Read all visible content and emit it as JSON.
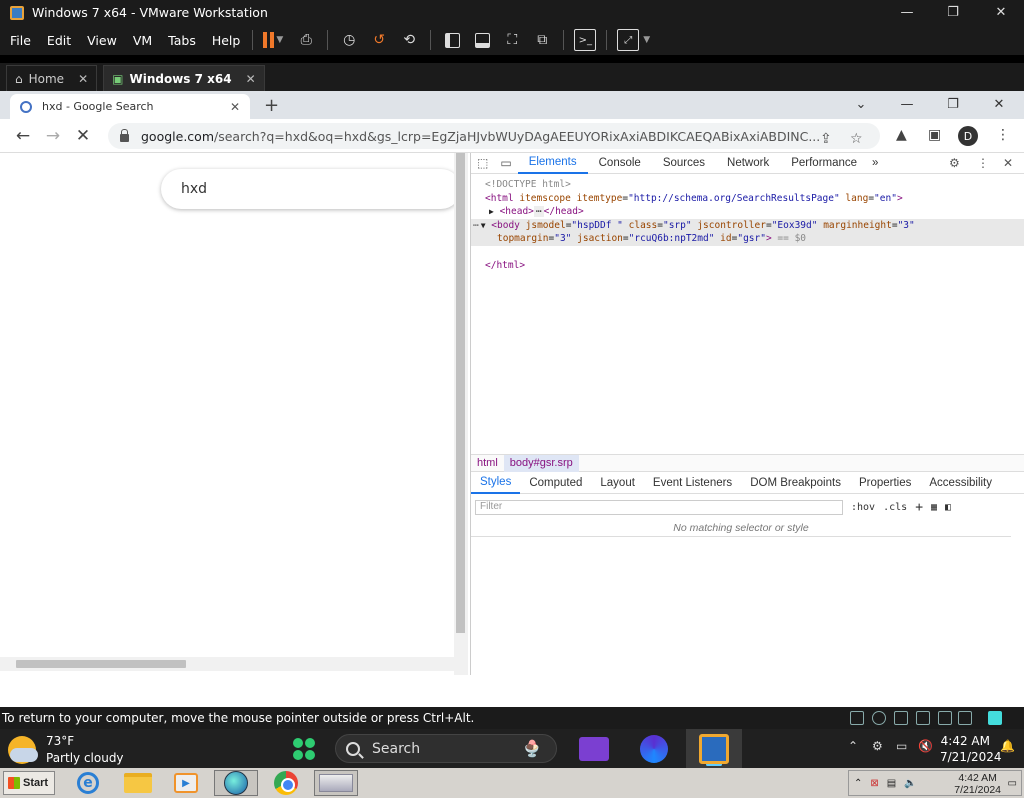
{
  "vmware": {
    "window_title": "Windows 7 x64 - VMware Workstation",
    "menu": [
      "File",
      "Edit",
      "View",
      "VM",
      "Tabs",
      "Help"
    ],
    "tabs": [
      {
        "label": "Home"
      },
      {
        "label": "Windows 7 x64"
      }
    ],
    "status_message": "To return to your computer, move the mouse pointer outside or press Ctrl+Alt."
  },
  "chrome": {
    "tab_title": "hxd - Google Search",
    "url_host": "google.com",
    "url_rest": "/search?q=hxd&oq=hxd&gs_lcrp=EgZjaHJvbWUyDAgAEEUYORixAxiABDIKCAEQABixAxiABDINC...",
    "profile_initial": "D"
  },
  "page": {
    "search_query": "hxd"
  },
  "devtools": {
    "tabs": [
      "Elements",
      "Console",
      "Sources",
      "Network",
      "Performance"
    ],
    "more_tabs": "»",
    "dom": {
      "doctype": "<!DOCTYPE html>",
      "html_open_tag": "<html",
      "html_attr1_name": "itemscope",
      "html_attr2_name": "itemtype",
      "html_attr2_value": "\"http://schema.org/SearchResultsPage\"",
      "html_attr3_name": "lang",
      "html_attr3_value": "\"en\"",
      "html_close_bracket": ">",
      "head_open": "<head>",
      "ellipsis": "⋯",
      "head_close": "</head>",
      "body_tag": "<body",
      "body_attr1_name": "jsmodel",
      "body_attr1_value": "\"hspDDf \"",
      "body_attr2_name": "class",
      "body_attr2_value": "\"srp\"",
      "body_attr3_name": "jscontroller",
      "body_attr3_value": "\"Eox39d\"",
      "body_attr4_name": "marginheight",
      "body_attr4_value": "\"3\"",
      "body_attr5_name": "topmargin",
      "body_attr5_value": "\"3\"",
      "body_attr6_name": "jsaction",
      "body_attr6_value": "\"rcuQ6b:npT2md\"",
      "body_attr7_name": "id",
      "body_attr7_value": "\"gsr\"",
      "body_close_bracket": ">",
      "selected_suffix": "== $0",
      "html_close": "</html>"
    },
    "breadcrumb": [
      "html",
      "body#gsr.srp"
    ],
    "styles_tabs": [
      "Styles",
      "Computed",
      "Layout",
      "Event Listeners",
      "DOM Breakpoints",
      "Properties",
      "Accessibility"
    ],
    "filter_placeholder": "Filter",
    "hov": ":hov",
    "cls": ".cls",
    "no_match": "No matching selector or style"
  },
  "xp_taskbar": {
    "start_label": "Start",
    "clock_time": "4:42 AM",
    "clock_date": "7/21/2024"
  },
  "win11_taskbar": {
    "temperature": "73°F",
    "weather": "Partly cloudy",
    "search_label": "Search",
    "clock_time": "4:42 AM",
    "clock_date": "7/21/2024"
  },
  "colors": {
    "accent": "#1a73e8",
    "vmware_bar": "#1b1b1b",
    "pause": "#f0782a"
  }
}
